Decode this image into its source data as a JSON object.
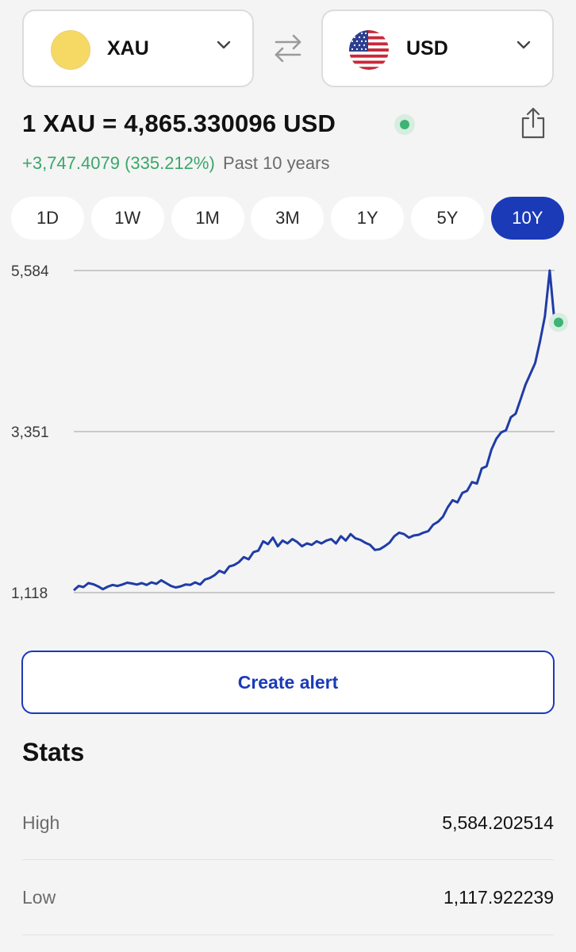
{
  "converter": {
    "from": {
      "code": "XAU",
      "icon": "gold-coin-icon"
    },
    "to": {
      "code": "USD",
      "icon": "us-flag-icon"
    },
    "swap_icon": "swap-arrows-icon"
  },
  "rate": {
    "title": "1 XAU = 4,865.330096 USD",
    "change": "+3,747.4079 (335.212%)",
    "period": "Past 10 years",
    "live_color": "#3db374",
    "positive_color": "#3aa769"
  },
  "ranges": {
    "items": [
      "1D",
      "1W",
      "1M",
      "3M",
      "1Y",
      "5Y",
      "10Y"
    ],
    "selected": "10Y",
    "accent": "#1a3ab8"
  },
  "chart_data": {
    "type": "line",
    "y_ticks": [
      "5,584",
      "3,351",
      "1,118"
    ],
    "ylim": [
      1118,
      5584
    ],
    "grid": true,
    "x_label": "",
    "y_label": "",
    "series": [
      {
        "color": "#1f3ca6",
        "values": [
          1150,
          1210,
          1195,
          1250,
          1235,
          1205,
          1165,
          1200,
          1225,
          1210,
          1230,
          1255,
          1245,
          1230,
          1250,
          1225,
          1260,
          1240,
          1290,
          1250,
          1210,
          1190,
          1205,
          1230,
          1225,
          1260,
          1230,
          1300,
          1320,
          1360,
          1420,
          1390,
          1480,
          1500,
          1540,
          1610,
          1580,
          1680,
          1700,
          1830,
          1790,
          1880,
          1760,
          1840,
          1800,
          1860,
          1820,
          1760,
          1800,
          1780,
          1830,
          1800,
          1840,
          1860,
          1800,
          1900,
          1840,
          1930,
          1870,
          1850,
          1810,
          1780,
          1710,
          1720,
          1760,
          1810,
          1900,
          1950,
          1930,
          1880,
          1910,
          1920,
          1950,
          1970,
          2060,
          2100,
          2170,
          2300,
          2400,
          2370,
          2500,
          2530,
          2650,
          2630,
          2840,
          2870,
          3100,
          3250,
          3340,
          3370,
          3550,
          3600,
          3800,
          4000,
          4150,
          4300,
          4600,
          4950,
          5584,
          4865
        ]
      }
    ]
  },
  "alert": {
    "label": "Create alert"
  },
  "stats": {
    "title": "Stats",
    "rows": [
      {
        "label": "High",
        "value": "5,584.202514"
      },
      {
        "label": "Low",
        "value": "1,117.922239"
      }
    ]
  }
}
